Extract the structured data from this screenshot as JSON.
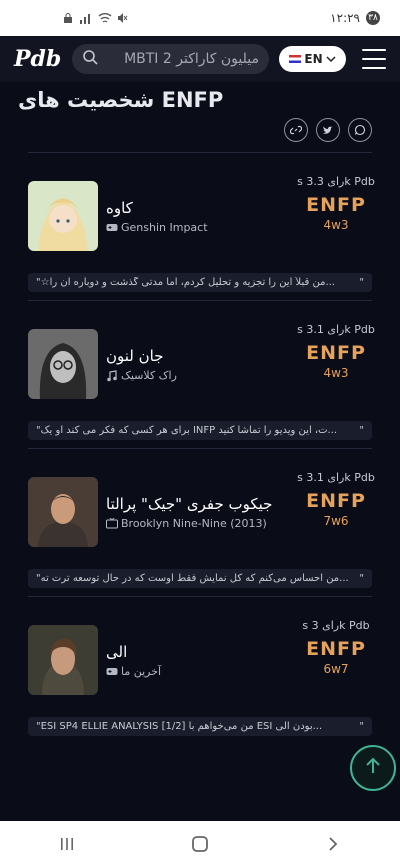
{
  "status": {
    "time": "۱۲:۲۹",
    "badge": "۳۸"
  },
  "header": {
    "logo": "Pdb",
    "search_placeholder": "میلیون کاراکتر MBTI 2",
    "lang_label": "EN"
  },
  "page": {
    "title": "شخصیت های ENFP"
  },
  "share": {
    "link": "🔗",
    "twitter": "🐦",
    "whatsapp": "✆"
  },
  "cards": [
    {
      "name": "کاوه",
      "category": "Genshin Impact",
      "votes": "s رای 3.3k Pdb",
      "mbti": "ENFP",
      "enneagram": "4w3",
      "quote": "...من قبلاً این را تجزیه و تحلیل کردم، اما مدتی گذشت و دوباره آن را☆\"",
      "quote_mark": "\""
    },
    {
      "name": "جان لنون",
      "category": "راک کلاسیک",
      "votes": "s رای 3.1k Pdb",
      "mbti": "ENFP",
      "enneagram": "4w3",
      "quote": "...ت، این ویدیو را تماشا کنید INFP برای هر کسی که فکر می کند او یک\"",
      "quote_mark": "\""
    },
    {
      "name": "جیکوب جفری \"جیک\" پرالتا",
      "category": "Brooklyn Nine-Nine (2013)",
      "votes": "s رای 3.1k Pdb",
      "mbti": "ENFP",
      "enneagram": "7w6",
      "quote": "...من احساس می‌کنم که کل نمایش فقط اوست که در حال توسعه ترت ته\"",
      "quote_mark": "\""
    },
    {
      "name": "الی",
      "category": "آخرین ما",
      "votes": "s رای 3k Pdb",
      "mbti": "ENFP",
      "enneagram": "6w7",
      "quote": "...بودن الی ESI من می‌خواهم با ESI SP4 ELLIE ANALYSIS [1/2]\"",
      "quote_mark": "\""
    }
  ]
}
